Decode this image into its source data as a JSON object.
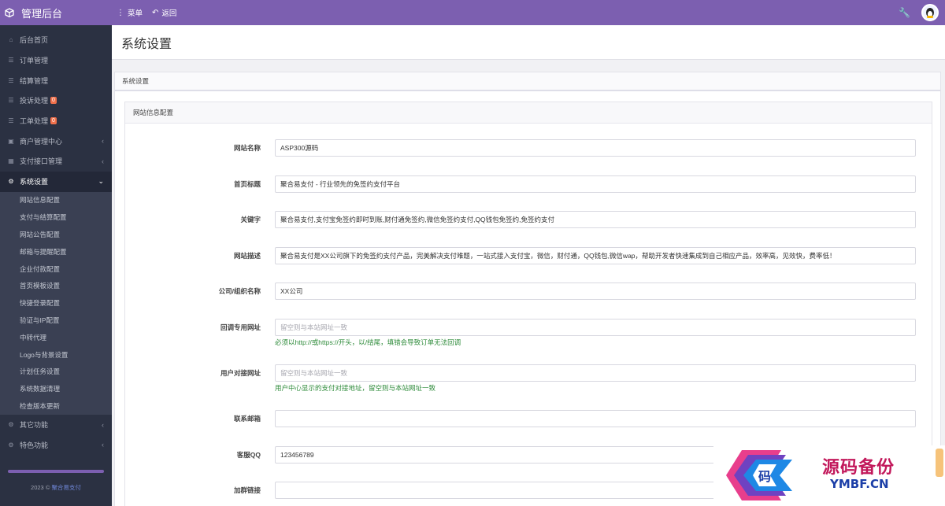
{
  "app": {
    "title": "管理后台"
  },
  "topnav": {
    "menu": "菜单",
    "back": "返回"
  },
  "sidebar": {
    "items": [
      {
        "label": "后台首页",
        "icon": "home-icon"
      },
      {
        "label": "订单管理",
        "icon": "list-icon"
      },
      {
        "label": "结算管理",
        "icon": "list-icon"
      },
      {
        "label": "投诉处理",
        "icon": "list-icon",
        "badge": "0"
      },
      {
        "label": "工单处理",
        "icon": "list-icon",
        "badge": "0"
      },
      {
        "label": "商户管理中心",
        "icon": "store-icon"
      },
      {
        "label": "支付接口管理",
        "icon": "grid-icon"
      },
      {
        "label": "系统设置",
        "icon": "gear-icon"
      }
    ],
    "sub_items": [
      "网站信息配置",
      "支付与结算配置",
      "网站公告配置",
      "邮箱与提醒配置",
      "企业付款配置",
      "首页模板设置",
      "快捷登录配置",
      "验证与IP配置",
      "中转代理",
      "Logo与背景设置",
      "计划任务设置",
      "系统数据清理",
      "检查版本更新"
    ],
    "bottom_items": [
      {
        "label": "其它功能",
        "icon": "cogs-icon"
      },
      {
        "label": "特色功能",
        "icon": "cogs-icon"
      }
    ],
    "footer": {
      "year": "2023 ©",
      "brand": "聚合易支付"
    }
  },
  "page": {
    "title": "系统设置",
    "panel_title": "系统设置",
    "section_title": "网站信息配置"
  },
  "form": [
    {
      "label": "网站名称",
      "value": "ASP300源码",
      "placeholder": ""
    },
    {
      "label": "首页标题",
      "value": "聚合易支付 - 行业领先的免签约支付平台",
      "placeholder": ""
    },
    {
      "label": "关键字",
      "value": "聚合易支付,支付宝免签约即时到账,财付通免签约,微信免签约支付,QQ钱包免签约,免签约支付",
      "placeholder": ""
    },
    {
      "label": "网站描述",
      "value": "聚合易支付是XX公司旗下的免签约支付产品，完美解决支付难题，一站式接入支付宝，微信，财付通，QQ钱包,微信wap，帮助开发者快速集成到自己相应产品，效率高，见效快，费率低！",
      "placeholder": ""
    },
    {
      "label": "公司/组织名称",
      "value": "XX公司",
      "placeholder": ""
    },
    {
      "label": "回调专用网址",
      "value": "",
      "placeholder": "留空则与本站网址一致",
      "help": "必须以http://或https://开头，以/结尾，填错会导致订单无法回调"
    },
    {
      "label": "用户对接网址",
      "value": "",
      "placeholder": "留空则与本站网址一致",
      "help": "用户中心显示的支付对接地址，留空则与本站网址一致"
    },
    {
      "label": "联系邮箱",
      "value": "",
      "placeholder": ""
    },
    {
      "label": "客服QQ",
      "value": "123456789",
      "placeholder": ""
    },
    {
      "label": "加群链接",
      "value": "",
      "placeholder": ""
    }
  ],
  "watermark": {
    "glyph": "码",
    "cn": "源码备份",
    "en": "YMBF.CN"
  },
  "colors": {
    "topbar": "#7c5fb0",
    "sidebar": "#2b3142",
    "help": "#2e8b3a",
    "badge": "#f0704b"
  }
}
